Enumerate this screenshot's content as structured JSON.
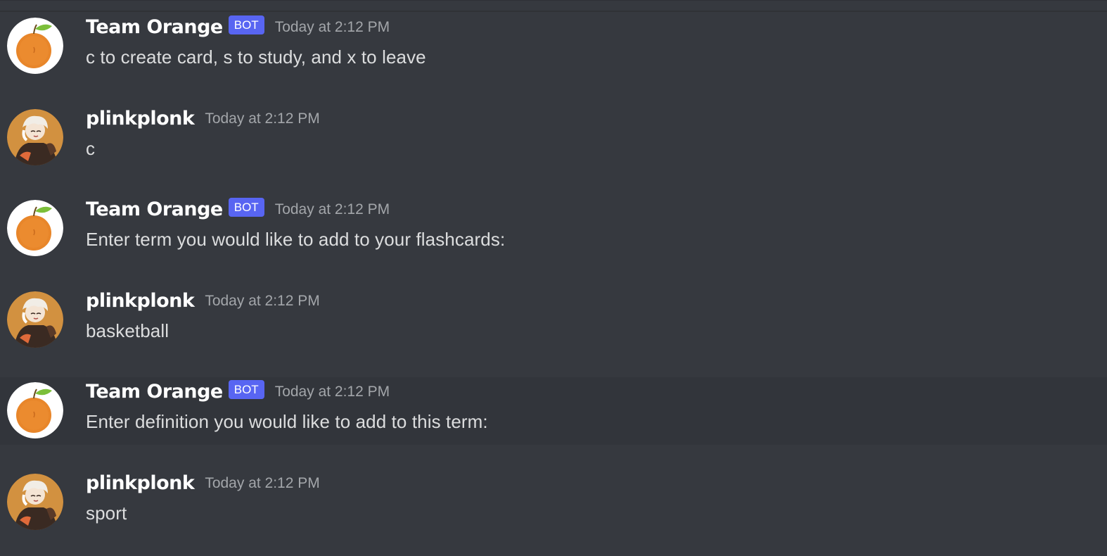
{
  "colors": {
    "background": "#36393f",
    "hover_background": "#32353b",
    "bot_tag": "#5865f2",
    "username": "#ffffff",
    "timestamp": "#a3a6aa",
    "text": "#dcddde"
  },
  "messages": [
    {
      "author": "Team Orange",
      "bot_tag": "BOT",
      "timestamp": "Today at 2:12 PM",
      "content": "c to create card, s to study, and x to leave",
      "avatar_icon": "orange-avatar-icon"
    },
    {
      "author": "plinkplonk",
      "timestamp": "Today at 2:12 PM",
      "content": "c",
      "avatar_icon": "anime-character-avatar-icon"
    },
    {
      "author": "Team Orange",
      "bot_tag": "BOT",
      "timestamp": "Today at 2:12 PM",
      "content": "Enter term you would like to add to your flashcards:",
      "avatar_icon": "orange-avatar-icon"
    },
    {
      "author": "plinkplonk",
      "timestamp": "Today at 2:12 PM",
      "content": "basketball",
      "avatar_icon": "anime-character-avatar-icon"
    },
    {
      "author": "Team Orange",
      "bot_tag": "BOT",
      "timestamp": "Today at 2:12 PM",
      "content": "Enter definition you would like to add to this term:",
      "avatar_icon": "orange-avatar-icon"
    },
    {
      "author": "plinkplonk",
      "timestamp": "Today at 2:12 PM",
      "content": "sport",
      "avatar_icon": "anime-character-avatar-icon"
    }
  ]
}
